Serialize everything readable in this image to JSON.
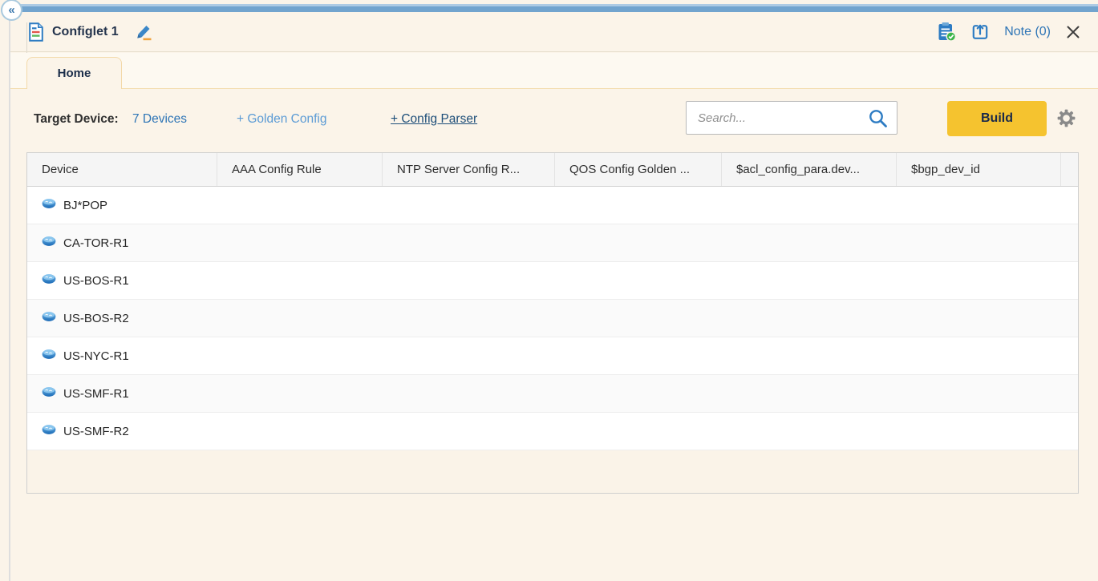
{
  "panel": {
    "collapse_glyph": "«",
    "title": "Configlet 1",
    "note_label": "Note (0)"
  },
  "tabs": {
    "home": "Home"
  },
  "toolbar": {
    "target_device_label": "Target Device:",
    "target_device_count": "7 Devices",
    "golden_config_label": "+ Golden Config",
    "config_parser_label": "+ Config Parser",
    "search_placeholder": "Search...",
    "build_label": "Build"
  },
  "table": {
    "columns": [
      "Device",
      "AAA Config Rule",
      "NTP Server Config R...",
      "QOS Config Golden ...",
      "$acl_config_para.dev...",
      "$bgp_dev_id"
    ],
    "rows": [
      {
        "device": "BJ*POP"
      },
      {
        "device": "CA-TOR-R1"
      },
      {
        "device": "US-BOS-R1"
      },
      {
        "device": "US-BOS-R2"
      },
      {
        "device": "US-NYC-R1"
      },
      {
        "device": "US-SMF-R1"
      },
      {
        "device": "US-SMF-R2"
      }
    ]
  },
  "icons": {
    "collapse": "double-left-chevron",
    "configlet": "document-with-lines",
    "edit": "pencil",
    "report": "clipboard-with-green-check",
    "export": "box-with-up-arrow",
    "close": "x-cross",
    "search": "magnifier",
    "settings": "gear",
    "device": "blue-router"
  },
  "colors": {
    "panel_cream": "#FBF4E9",
    "strip_blue": "#72A4CE",
    "accent_yellow": "#F5C32F",
    "link_blue": "#2E75B6",
    "light_link_blue": "#5B9BD5",
    "dark_link_blue": "#1D4E79",
    "icon_blue": "#2E7CC3",
    "icon_green": "#3CB54A",
    "tab_border": "#F3D9A9"
  }
}
